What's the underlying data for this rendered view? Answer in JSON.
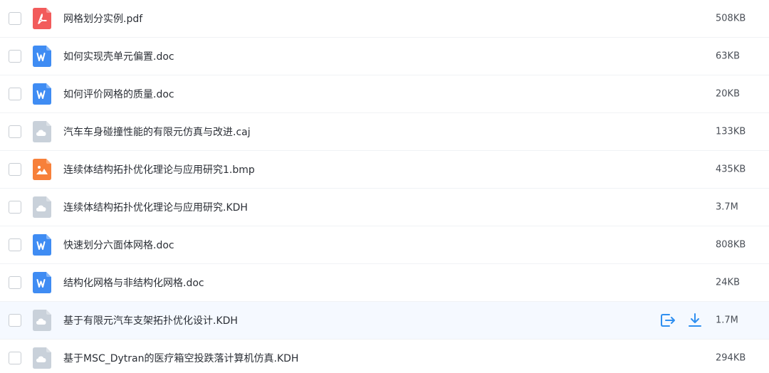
{
  "files": [
    {
      "name": "网格划分实例.pdf",
      "size": "508KB",
      "type": "pdf"
    },
    {
      "name": "如何实现壳单元偏置.doc",
      "size": "63KB",
      "type": "doc"
    },
    {
      "name": "如何评价网格的质量.doc",
      "size": "20KB",
      "type": "doc"
    },
    {
      "name": "汽车车身碰撞性能的有限元仿真与改进.caj",
      "size": "133KB",
      "type": "other"
    },
    {
      "name": "连续体结构拓扑优化理论与应用研究1.bmp",
      "size": "435KB",
      "type": "image"
    },
    {
      "name": "连续体结构拓扑优化理论与应用研究.KDH",
      "size": "3.7M",
      "type": "other"
    },
    {
      "name": "快速划分六面体网格.doc",
      "size": "808KB",
      "type": "doc"
    },
    {
      "name": "结构化网格与非结构化网格.doc",
      "size": "24KB",
      "type": "doc"
    },
    {
      "name": "基于有限元汽车支架拓扑优化设计.KDH",
      "size": "1.7M",
      "type": "other",
      "hovered": true
    },
    {
      "name": "基于MSC_Dytran的医疗箱空投跌落计算机仿真.KDH",
      "size": "294KB",
      "type": "other"
    }
  ],
  "icons": {
    "pdf": "pdf-file-icon",
    "doc": "word-doc-icon",
    "image": "image-file-icon",
    "other": "generic-file-icon",
    "share": "share-icon",
    "download": "download-icon"
  },
  "colors": {
    "pdf": "#f25b5b",
    "doc": "#3f8cf3",
    "image": "#f7803a",
    "other": "#c9d1da",
    "action": "#2f8ff0",
    "hover_bg": "#f5f9ff"
  }
}
